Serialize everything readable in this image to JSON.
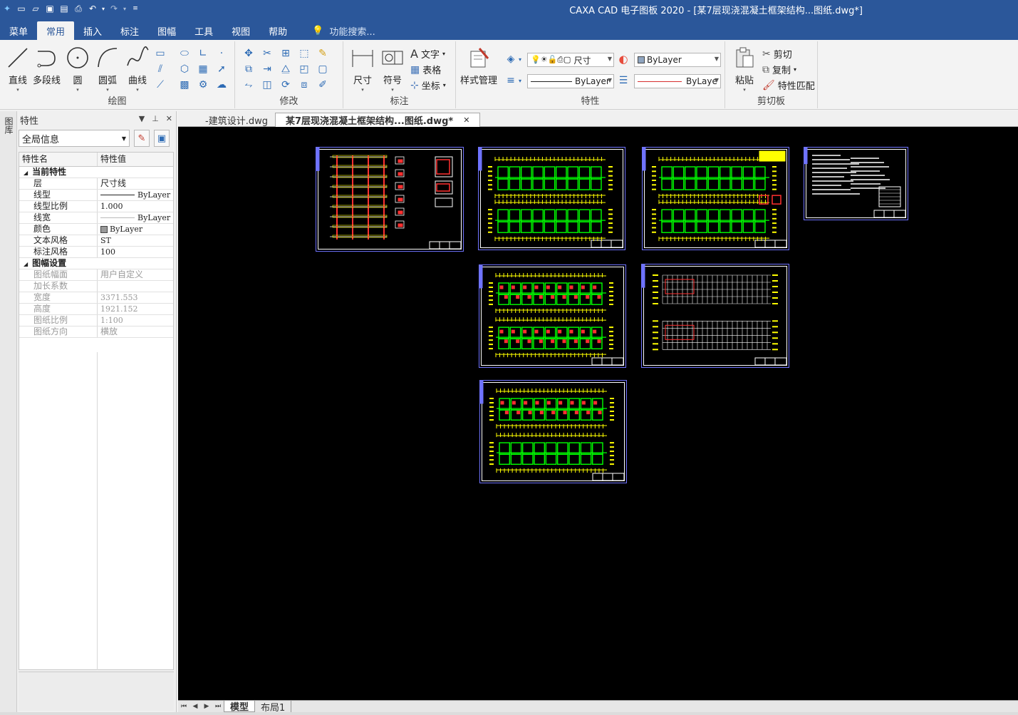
{
  "app": {
    "window_title": "CAXA CAD 电子图板 2020 - [某7层现浇混凝土框架结构...图纸.dwg*]"
  },
  "menu": {
    "tabs": [
      {
        "label": "菜单"
      },
      {
        "label": "常用"
      },
      {
        "label": "插入"
      },
      {
        "label": "标注"
      },
      {
        "label": "图幅"
      },
      {
        "label": "工具"
      },
      {
        "label": "视图"
      },
      {
        "label": "帮助"
      }
    ],
    "active_tab": "常用",
    "search_label": "功能搜索..."
  },
  "ribbon": {
    "draw": {
      "label": "绘图",
      "line": "直线",
      "polyline": "多段线",
      "circle": "圆",
      "arc": "圆弧",
      "curve": "曲线"
    },
    "modify": {
      "label": "修改"
    },
    "dim": {
      "label": "标注",
      "dimension": "尺寸",
      "symbol": "符号",
      "text": "文字",
      "table": "表格",
      "coord": "坐标"
    },
    "props": {
      "label": "特性",
      "style_manager": "样式管理",
      "layer_value": "尺寸",
      "color_value": "ByLayer",
      "linetype_value": "ByLayer",
      "lineweight_value": "ByLaye"
    },
    "clipboard": {
      "label": "剪切板",
      "paste": "粘贴",
      "cut": "剪切",
      "copy": "复制",
      "match": "特性匹配"
    }
  },
  "panel": {
    "title": "特性",
    "side_tab": "图库",
    "scope": "全局信息",
    "col_name": "特性名",
    "col_value": "特性值",
    "cat_current": "当前特性",
    "cat_sheet": "图幅设置",
    "current": [
      {
        "name": "层",
        "value": "尺寸线"
      },
      {
        "name": "线型",
        "value": "ByLayer"
      },
      {
        "name": "线型比例",
        "value": "1.000"
      },
      {
        "name": "线宽",
        "value": "ByLayer"
      },
      {
        "name": "颜色",
        "value": "ByLayer"
      },
      {
        "name": "文本风格",
        "value": "ST"
      },
      {
        "name": "标注风格",
        "value": "100"
      }
    ],
    "sheet": [
      {
        "name": "图纸幅面",
        "value": "用户自定义"
      },
      {
        "name": "加长系数",
        "value": ""
      },
      {
        "name": "宽度",
        "value": "3371.553"
      },
      {
        "name": "高度",
        "value": "1921.152"
      },
      {
        "name": "图纸比例",
        "value": "1:100"
      },
      {
        "name": "图纸方向",
        "value": "横放"
      }
    ]
  },
  "doc_tabs": {
    "tab1": "-建筑设计.dwg",
    "tab2": "某7层现浇混凝土框架结构...图纸.dwg*"
  },
  "layout_tabs": {
    "model": "模型",
    "layout1": "布局1"
  }
}
